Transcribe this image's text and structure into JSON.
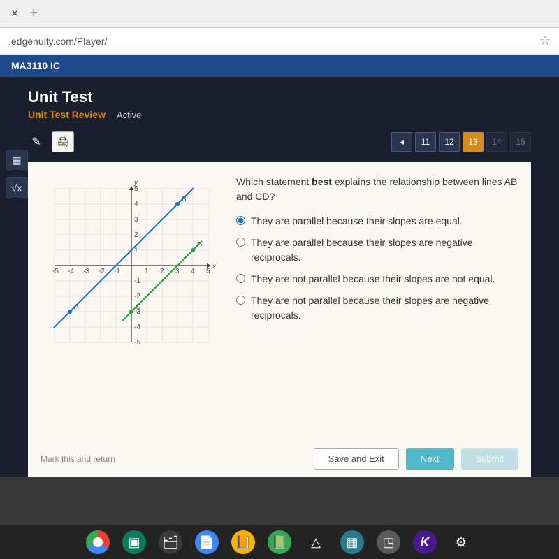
{
  "browser": {
    "url": ".edgenuity.com/Player/"
  },
  "course": {
    "code": "MA3110 IC"
  },
  "header": {
    "title": "Unit Test",
    "subtitle": "Unit Test Review",
    "status": "Active"
  },
  "nav": {
    "prev": "◂",
    "items": [
      "11",
      "12",
      "13",
      "14",
      "15"
    ],
    "current": "13"
  },
  "question": {
    "prompt_pre": "Which statement ",
    "prompt_bold": "best",
    "prompt_post": " explains the relationship between lines AB and CD?",
    "options": [
      "They are parallel because their slopes are equal.",
      "They are parallel because their slopes are negative reciprocals.",
      "They are not parallel because their slopes are not equal.",
      "They are not parallel because their slopes are negative reciprocals."
    ],
    "selected": 0
  },
  "actions": {
    "mark": "Mark this and return",
    "save": "Save and Exit",
    "next": "Next",
    "submit": "Submit"
  },
  "chart_data": {
    "type": "line",
    "title": "",
    "xlabel": "x",
    "ylabel": "y",
    "xlim": [
      -5,
      5
    ],
    "ylim": [
      -5,
      5
    ],
    "x_ticks": [
      -5,
      -4,
      -3,
      -2,
      -1,
      1,
      2,
      3,
      4,
      5
    ],
    "y_ticks": [
      -5,
      -4,
      -3,
      -2,
      -1,
      1,
      2,
      3,
      4,
      5
    ],
    "series": [
      {
        "name": "AB",
        "color": "#2066d6",
        "points": [
          [
            -4,
            -3
          ],
          [
            3,
            4
          ]
        ],
        "labels": {
          "A": [
            -4,
            -3
          ],
          "B": [
            3,
            4
          ]
        }
      },
      {
        "name": "CD",
        "color": "#2a9a3a",
        "points": [
          [
            0,
            -3
          ],
          [
            4,
            1
          ]
        ],
        "labels": {
          "C": [
            0,
            -3
          ],
          "D": [
            4,
            1
          ]
        }
      }
    ]
  },
  "tools": {
    "print": "🖨",
    "pencil": "✎",
    "calc": "▦",
    "sqrt": "√x"
  }
}
